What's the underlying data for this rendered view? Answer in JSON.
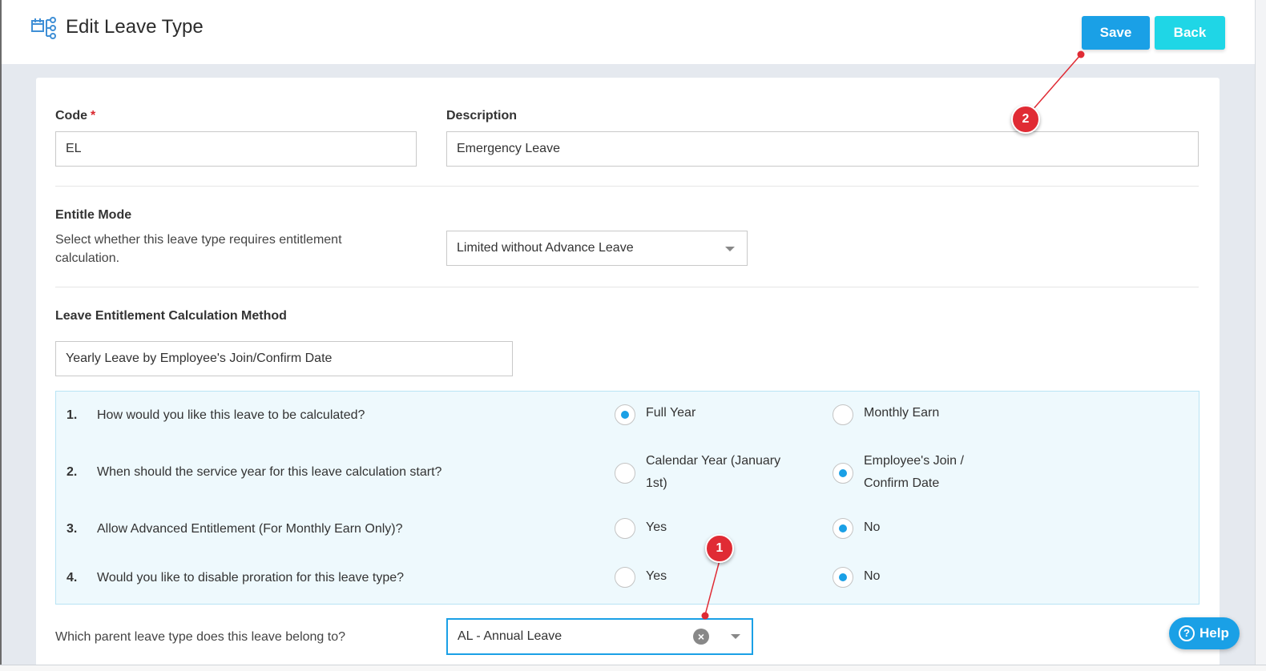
{
  "header": {
    "title": "Edit Leave Type",
    "save_label": "Save",
    "back_label": "Back"
  },
  "form": {
    "code_label": "Code",
    "code_required_mark": "*",
    "code_value": "EL",
    "description_label": "Description",
    "description_value": "Emergency Leave",
    "entitle_mode_label": "Entitle Mode",
    "entitle_mode_help": "Select whether this leave type requires entitlement calculation.",
    "entitle_mode_value": "Limited without Advance Leave",
    "calc_method_label": "Leave Entitlement Calculation Method",
    "calc_method_value": "Yearly Leave by Employee's Join/Confirm Date",
    "questions": [
      {
        "num": "1.",
        "text": "How would you like this leave to be calculated?",
        "option_a": "Full Year",
        "option_b": "Monthly Earn",
        "selected": "a"
      },
      {
        "num": "2.",
        "text": "When should the service year for this leave calculation start?",
        "option_a": "Calendar Year (January 1st)",
        "option_b": "Employee's Join / Confirm Date",
        "selected": "b"
      },
      {
        "num": "3.",
        "text": "Allow Advanced Entitlement (For Monthly Earn Only)?",
        "option_a": "Yes",
        "option_b": "No",
        "selected": "b"
      },
      {
        "num": "4.",
        "text": "Would you like to disable proration for this leave type?",
        "option_a": "Yes",
        "option_b": "No",
        "selected": "b"
      }
    ],
    "parent_label": "Which parent leave type does this leave belong to?",
    "parent_value": "AL - Annual Leave"
  },
  "help": {
    "label": "Help",
    "icon_glyph": "?"
  },
  "annotations": [
    {
      "label": "1"
    },
    {
      "label": "2"
    }
  ],
  "colors": {
    "primary": "#1aa0e6",
    "back": "#1fd6e6",
    "annotation": "#e02b34",
    "question_bg": "#eef9fd"
  },
  "icons": {
    "header": "calendar-tree-icon",
    "dropdown": "chevron-down-icon",
    "clear": "clear-icon",
    "help": "question-circle-icon"
  }
}
